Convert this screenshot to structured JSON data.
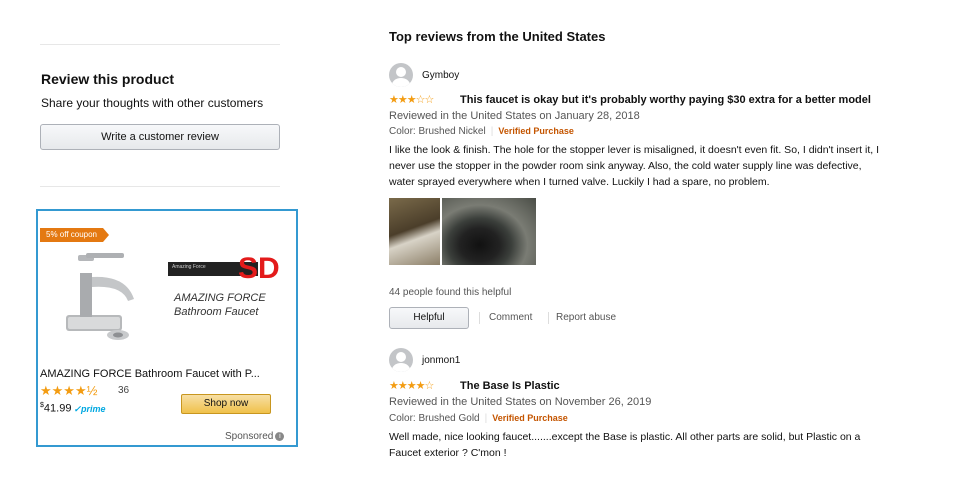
{
  "sidebar": {
    "review_heading": "Review this product",
    "review_subtext": "Share your thoughts with other customers",
    "write_review_label": "Write a customer review"
  },
  "ad": {
    "coupon": "5% off coupon",
    "sd_mark": "SD",
    "brand_line1": "AMAZING FORCE",
    "brand_line2": "Bathroom Faucet",
    "logo_text": "Amazing Force",
    "title": "AMAZING FORCE Bathroom Faucet with P...",
    "stars": "★★★★½",
    "rating": 4.5,
    "review_count": "36",
    "price_symbol": "$",
    "price": "41.99",
    "prime": "prime",
    "shop_label": "Shop now",
    "sponsored": "Sponsored",
    "info_icon": "i"
  },
  "reviews_section": {
    "heading": "Top reviews from the United States",
    "reviews": [
      {
        "name": "Gymboy",
        "stars": "★★★☆☆",
        "rating": 3,
        "title": "This faucet is okay but it's probably worthy paying $30 extra for a better model",
        "date": "Reviewed in the United States on January 28, 2018",
        "color": "Color: Brushed Nickel",
        "verified": "Verified Purchase",
        "body_lines": [
          "I like the look & finish. The hole for the stopper lever is misaligned, it doesn't even fit. So, I didn't insert it, I",
          "never use the stopper in the powder room sink anyway. Also, the cold water supply line was defective,",
          "water sprayed everywhere when I turned valve. Luckily I had a spare, no problem."
        ],
        "helpful_count": "44 people found this helpful",
        "helpful_label": "Helpful",
        "comment_label": "Comment",
        "abuse_label": "Report abuse"
      },
      {
        "name": "jonmon1",
        "stars": "★★★★☆",
        "rating": 4,
        "title": "The Base Is Plastic",
        "date": "Reviewed in the United States on November 26, 2019",
        "color": "Color: Brushed Gold",
        "verified": "Verified Purchase",
        "body_lines": [
          "Well made, nice looking faucet.......except the Base is plastic. All other parts are solid, but Plastic on a",
          "Faucet exterior ? C'mon !"
        ]
      }
    ]
  },
  "colors": {
    "accent_orange": "#c45500",
    "star_color": "#f39c12",
    "ad_border": "#3499d1",
    "shop_button": "#f0c14b",
    "prime_blue": "#00a8e1",
    "sd_red": "#e31b1b"
  }
}
